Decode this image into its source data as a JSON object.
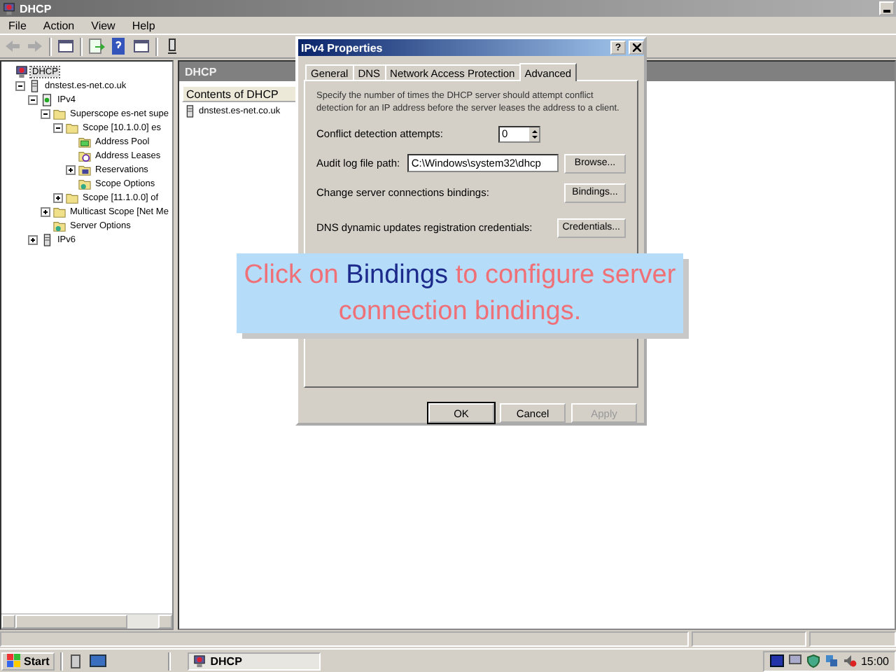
{
  "window": {
    "title": "DHCP"
  },
  "menu": [
    "File",
    "Action",
    "View",
    "Help"
  ],
  "tree": [
    {
      "label": "DHCP",
      "kind": "dhcp",
      "selected": true,
      "children": [
        {
          "label": "dnstest.es-net.co.uk",
          "kind": "server",
          "selected": false,
          "expanded": true,
          "children": [
            {
              "label": "IPv4",
              "kind": "ipv4",
              "selected": false,
              "expanded": true,
              "children": [
                {
                  "label": "Superscope es-net supe",
                  "kind": "folder",
                  "selected": false,
                  "expanded": true,
                  "children": [
                    {
                      "label": "Scope [10.1.0.0] es",
                      "kind": "folder",
                      "selected": false,
                      "expanded": true,
                      "children": [
                        {
                          "label": "Address Pool",
                          "kind": "pool",
                          "selected": false
                        },
                        {
                          "label": "Address Leases",
                          "kind": "leases",
                          "selected": false
                        },
                        {
                          "label": "Reservations",
                          "kind": "reservations",
                          "selected": false,
                          "expanded": false
                        },
                        {
                          "label": "Scope Options",
                          "kind": "options",
                          "selected": false
                        }
                      ]
                    },
                    {
                      "label": "Scope [11.1.0.0] of",
                      "kind": "folder",
                      "selected": false,
                      "expanded": false
                    }
                  ]
                },
                {
                  "label": "Multicast Scope [Net Me",
                  "kind": "folder",
                  "selected": false,
                  "expanded": false
                },
                {
                  "label": "Server Options",
                  "kind": "options",
                  "selected": false
                }
              ]
            },
            {
              "label": "IPv6",
              "kind": "server",
              "selected": false,
              "expanded": false
            }
          ]
        }
      ]
    }
  ],
  "pane": {
    "title": "DHCP",
    "column": "Contents of DHCP",
    "items": [
      "dnstest.es-net.co.uk"
    ]
  },
  "dialog": {
    "title": "IPv4 Properties",
    "help": "?",
    "tabs": [
      {
        "label": "General",
        "selected": false
      },
      {
        "label": "DNS",
        "selected": false
      },
      {
        "label": "Network Access Protection",
        "selected": false
      },
      {
        "label": "Advanced",
        "selected": true
      }
    ],
    "description": "Specify the number of times the DHCP server should attempt conflict detection for an IP address before the server leases the address to a client.",
    "conflict": {
      "label": "Conflict detection attempts:",
      "value": "0"
    },
    "audit": {
      "label": "Audit log file path:",
      "value": "C:\\Windows\\system32\\dhcp",
      "button": "Browse..."
    },
    "bindings": {
      "label": "Change server connections bindings:",
      "button": "Bindings..."
    },
    "credentials": {
      "label": "DNS dynamic updates registration credentials:",
      "button": "Credentials..."
    },
    "buttons": [
      {
        "label": "OK",
        "disabled": false,
        "default": true
      },
      {
        "label": "Cancel",
        "disabled": false,
        "default": false
      },
      {
        "label": "Apply",
        "disabled": true,
        "default": false
      }
    ]
  },
  "callout": "Click on **Bindings** to configure server connection bindings.",
  "taskbar": {
    "start": "Start",
    "task": "DHCP",
    "clock": "15:00"
  }
}
